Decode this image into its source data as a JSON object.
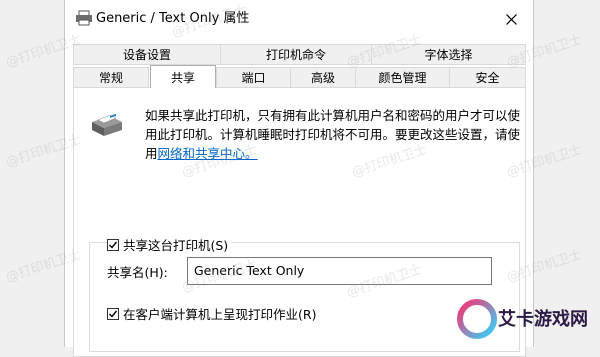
{
  "window": {
    "title": "Generic / Text Only 属性"
  },
  "tabs_row1": [
    {
      "label": "设备设置"
    },
    {
      "label": "打印机命令"
    },
    {
      "label": "字体选择"
    }
  ],
  "tabs_row2": [
    {
      "label": "常规"
    },
    {
      "label": "共享"
    },
    {
      "label": "端口"
    },
    {
      "label": "高级"
    },
    {
      "label": "颜色管理"
    },
    {
      "label": "安全"
    }
  ],
  "sharing": {
    "description": "如果共享此打印机，只有拥有此计算机用户名和密码的用户才可以使用此打印机。计算机睡眠时打印机将不可用。要更改这些设置，请使用",
    "link_text": "网络和共享中心。",
    "share_checkbox_label": "共享这台打印机(S)",
    "share_checked": true,
    "share_name_label": "共享名(H):",
    "share_name_value": "Generic  Text Only",
    "render_jobs_label": "在客户端计算机上呈现打印作业(R)",
    "render_jobs_checked": true
  },
  "watermark": {
    "text": "@打印机卫士"
  },
  "logo": {
    "text": "艾卡游戏网"
  },
  "colors": {
    "link": "#0066cc",
    "tab_active_bg": "#ffffff",
    "tab_bg": "#f0f0f0"
  }
}
